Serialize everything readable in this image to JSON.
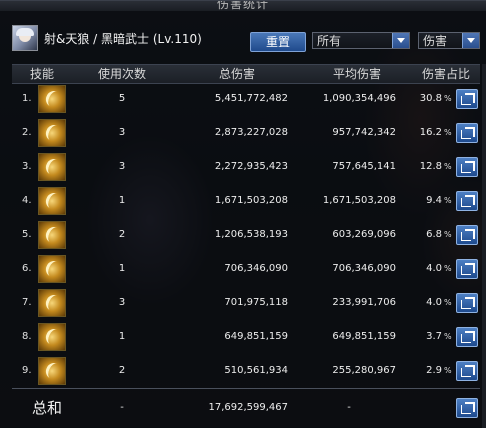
{
  "window": {
    "title": "伤害统计"
  },
  "player": {
    "name": "射&天狼 / 黑暗武士 (Lv.110)"
  },
  "controls": {
    "reset_label": "重置",
    "filter_value": "所有",
    "sort_value": "伤害"
  },
  "table": {
    "headers": [
      "技能",
      "使用次数",
      "总伤害",
      "平均伤害",
      "伤害占比"
    ],
    "rows": [
      {
        "index": "1.",
        "uses": "5",
        "total": "5,451,772,482",
        "avg": "1,090,354,496",
        "pct": "30.8",
        "pct_unit": "%"
      },
      {
        "index": "2.",
        "uses": "3",
        "total": "2,873,227,028",
        "avg": "957,742,342",
        "pct": "16.2",
        "pct_unit": "%"
      },
      {
        "index": "3.",
        "uses": "3",
        "total": "2,272,935,423",
        "avg": "757,645,141",
        "pct": "12.8",
        "pct_unit": "%"
      },
      {
        "index": "4.",
        "uses": "1",
        "total": "1,671,503,208",
        "avg": "1,671,503,208",
        "pct": "9.4",
        "pct_unit": "%"
      },
      {
        "index": "5.",
        "uses": "2",
        "total": "1,206,538,193",
        "avg": "603,269,096",
        "pct": "6.8",
        "pct_unit": "%"
      },
      {
        "index": "6.",
        "uses": "1",
        "total": "706,346,090",
        "avg": "706,346,090",
        "pct": "4.0",
        "pct_unit": "%"
      },
      {
        "index": "7.",
        "uses": "3",
        "total": "701,975,118",
        "avg": "233,991,706",
        "pct": "4.0",
        "pct_unit": "%"
      },
      {
        "index": "8.",
        "uses": "1",
        "total": "649,851,159",
        "avg": "649,851,159",
        "pct": "3.7",
        "pct_unit": "%"
      },
      {
        "index": "9.",
        "uses": "2",
        "total": "510,561,934",
        "avg": "255,280,967",
        "pct": "2.9",
        "pct_unit": "%"
      }
    ],
    "totals": {
      "label": "总和",
      "uses": "-",
      "total": "17,692,599,467",
      "avg": "-",
      "pct": "-"
    }
  },
  "icons": {
    "skill": "skill-icon",
    "share": "share-icon",
    "dropdown": "chevron-down-icon"
  },
  "colors": {
    "accent": "#2f5fa8",
    "skill_gold": "#d9a43a"
  }
}
